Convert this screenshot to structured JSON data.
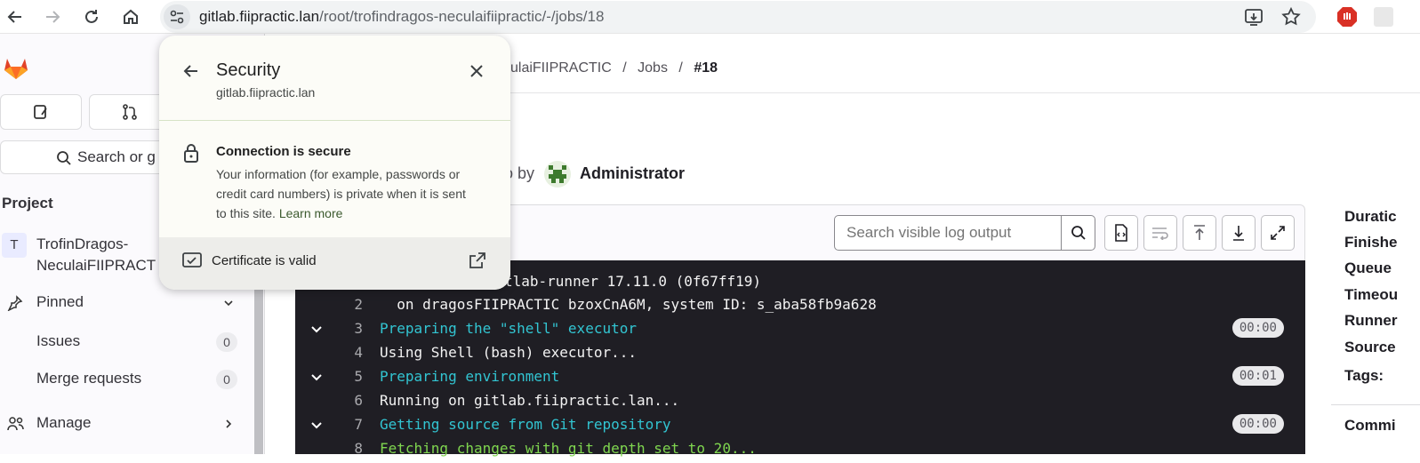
{
  "browser": {
    "url_host": "gitlab.fiipractic.lan",
    "url_path": "/root/trofindragos-neculaifiipractic/-/jobs/18"
  },
  "breadcrumb": {
    "project": "ulaiFIIPRACTIC",
    "jobs": "Jobs",
    "job": "#18",
    "sep1": "/",
    "sep2": "/"
  },
  "job_header": {
    "triggered_fragment": "o by",
    "user": "Administrator"
  },
  "sidebar": {
    "search_label": "Search or g",
    "project_heading": "Project",
    "project_avatar_letter": "T",
    "project_name_line1": "TrofinDragos-",
    "project_name_line2": "NeculaiFIIPRACT",
    "pinned_label": "Pinned",
    "items": [
      {
        "label": "Issues",
        "count": "0"
      },
      {
        "label": "Merge requests",
        "count": "0"
      }
    ],
    "manage_label": "Manage"
  },
  "toolbar": {
    "search_placeholder": "Search visible log output"
  },
  "log": {
    "lines": [
      {
        "num": "",
        "text": "tlab-runner 17.11.0 (0f67ff19)",
        "section": false,
        "time": ""
      },
      {
        "num": "2",
        "text": "  on dragosFIIPRACTIC bzoxCnA6M, system ID: s_aba58fb9a628",
        "section": false,
        "time": ""
      },
      {
        "num": "3",
        "text": "Preparing the \"shell\" executor",
        "section": true,
        "time": "00:00"
      },
      {
        "num": "4",
        "text": "Using Shell (bash) executor...",
        "section": false,
        "time": ""
      },
      {
        "num": "5",
        "text": "Preparing environment",
        "section": true,
        "time": "00:01"
      },
      {
        "num": "6",
        "text": "Running on gitlab.fiipractic.lan...",
        "section": false,
        "time": ""
      },
      {
        "num": "7",
        "text": "Getting source from Git repository",
        "section": true,
        "time": "00:00"
      },
      {
        "num": "8",
        "text": "Fetching changes with git depth set to 20...",
        "section": false,
        "time": ""
      }
    ]
  },
  "job_meta": {
    "labels": [
      "Duratic",
      "Finishe",
      "Queue",
      "Timeou",
      "Runner",
      "Source",
      "Tags:",
      "Commi"
    ]
  },
  "security_popup": {
    "title": "Security",
    "host": "gitlab.fiipractic.lan",
    "connection_title": "Connection is secure",
    "connection_desc_1": "Your information (for example, passwords or",
    "connection_desc_2": "credit card numbers) is private when it is sent",
    "connection_desc_3": "to this site.",
    "learn_more": "Learn more",
    "certificate_label": "Certificate is valid"
  },
  "colors": {
    "gitlab_orange": "#e24329",
    "log_section": "#32c5d2",
    "log_bg": "#1f1e24",
    "popup_bg": "#fcfcf7"
  }
}
